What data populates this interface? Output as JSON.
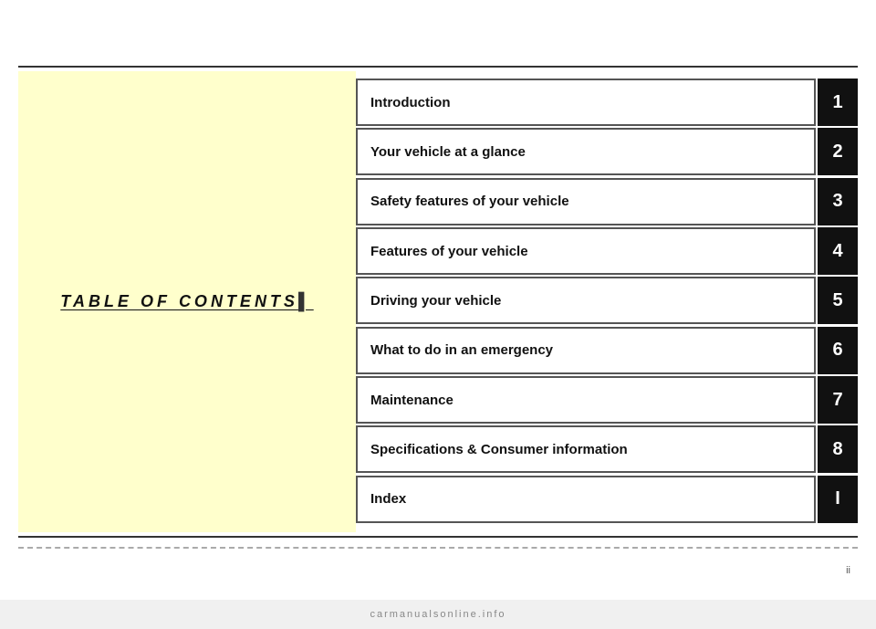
{
  "page": {
    "title": "TABLE OF CONTENTS",
    "title_cursor": "▌",
    "page_number": "ii"
  },
  "toc": {
    "items": [
      {
        "label": "Introduction",
        "number": "1"
      },
      {
        "label": "Your vehicle at a glance",
        "number": "2"
      },
      {
        "label": "Safety features of your vehicle",
        "number": "3"
      },
      {
        "label": "Features of your vehicle",
        "number": "4"
      },
      {
        "label": "Driving your vehicle",
        "number": "5"
      },
      {
        "label": "What to do in an emergency",
        "number": "6"
      },
      {
        "label": "Maintenance",
        "number": "7"
      },
      {
        "label": "Specifications & Consumer information",
        "number": "8"
      },
      {
        "label": "Index",
        "number": "I"
      }
    ]
  },
  "watermark": {
    "text": "carmanualsonline.info"
  }
}
